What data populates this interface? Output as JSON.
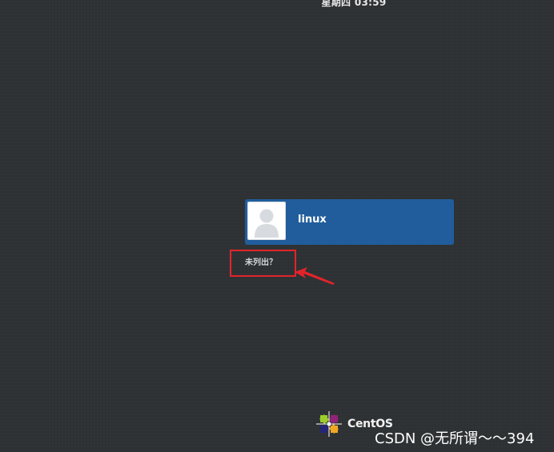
{
  "top_bar": {
    "clock": "星期四 03:59"
  },
  "login": {
    "users": [
      {
        "name": "linux",
        "avatar_icon": "user-avatar-icon"
      }
    ],
    "not_listed_label": "未列出？"
  },
  "annotation": {
    "highlight_color": "#e2242a"
  },
  "branding": {
    "logo_text": "CentOS",
    "logo_icon": "centos-logo-icon"
  },
  "watermark": {
    "text": "CSDN @无所谓～～394"
  },
  "colors": {
    "background": "#2e3133",
    "user_card": "#215d9c"
  }
}
